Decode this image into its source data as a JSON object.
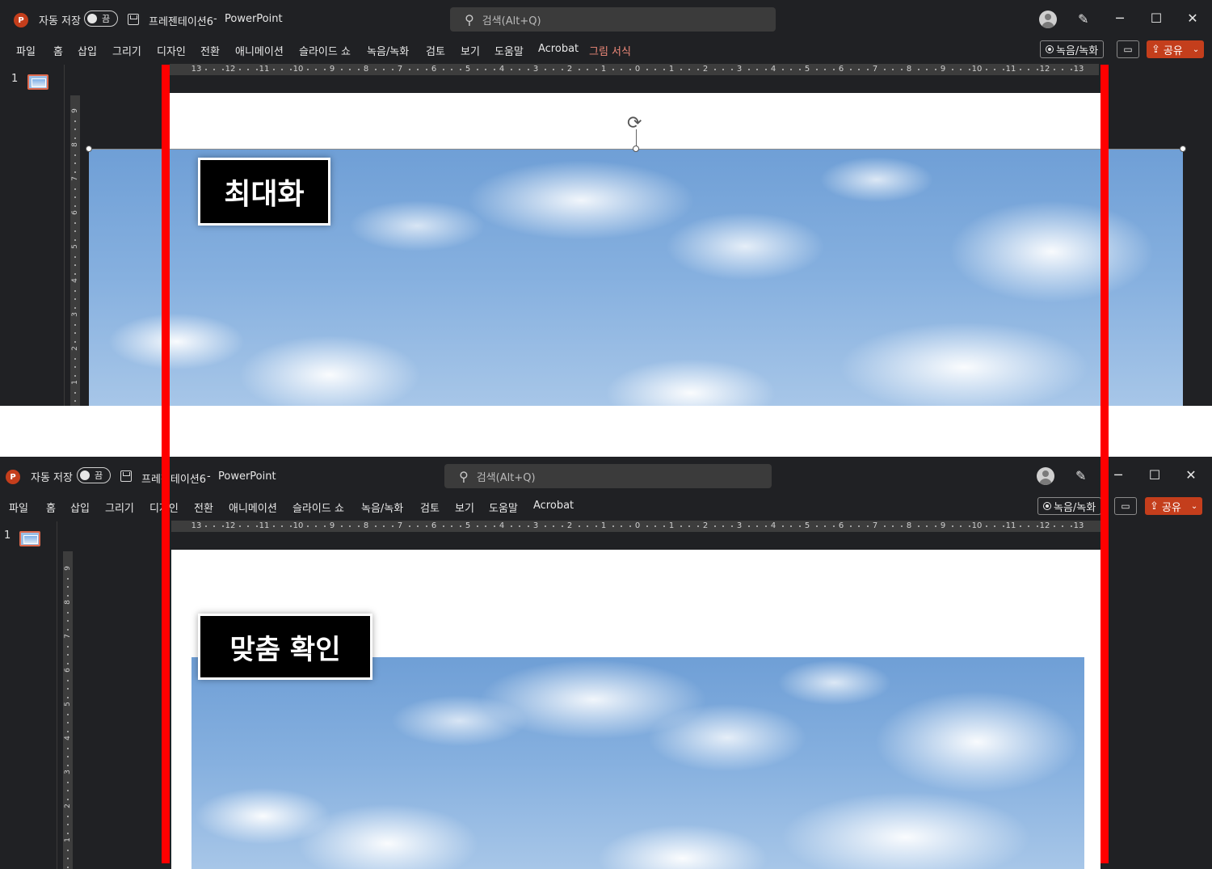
{
  "app": {
    "logo_letter": "P",
    "autosave_label": "자동 저장",
    "autosave_state": "끔",
    "document_title": "프레젠테이션6",
    "separator": "-",
    "app_name": "PowerPoint",
    "search_placeholder": "검색(Alt+Q)",
    "win_minimize": "─",
    "win_maximize": "☐",
    "win_close": "✕",
    "pen_glyph": "✎",
    "search_glyph": "⚲"
  },
  "ribbon": {
    "tabs": [
      "파일",
      "홈",
      "삽입",
      "그리기",
      "디자인",
      "전환",
      "애니메이션",
      "슬라이드 쇼",
      "녹음/녹화",
      "검토",
      "보기",
      "도움말",
      "Acrobat"
    ],
    "contextual_tab": "그림 서식",
    "record_button": "녹음/녹화",
    "comment_glyph": "▭",
    "share_button": "공유",
    "share_glyph": "⇪",
    "share_chevron": "⌄"
  },
  "thumbnails": {
    "slide_number": "1"
  },
  "ruler": {
    "horizontal_labels": [
      "13",
      "12",
      "11",
      "10",
      "9",
      "8",
      "7",
      "6",
      "5",
      "4",
      "3",
      "2",
      "1",
      "0",
      "1",
      "2",
      "3",
      "4",
      "5",
      "6",
      "7",
      "8",
      "9",
      "10",
      "11",
      "12",
      "13"
    ],
    "vertical_labels": [
      "9",
      "8",
      "7",
      "6",
      "5",
      "4",
      "3",
      "2",
      "1"
    ]
  },
  "callouts": {
    "top": "최대화",
    "bottom": "맞춤 확인"
  },
  "colors": {
    "accent_red": "#ff0000",
    "brand_powerpoint": "#c43e1c",
    "contextual_tab": "#f08a7a"
  }
}
